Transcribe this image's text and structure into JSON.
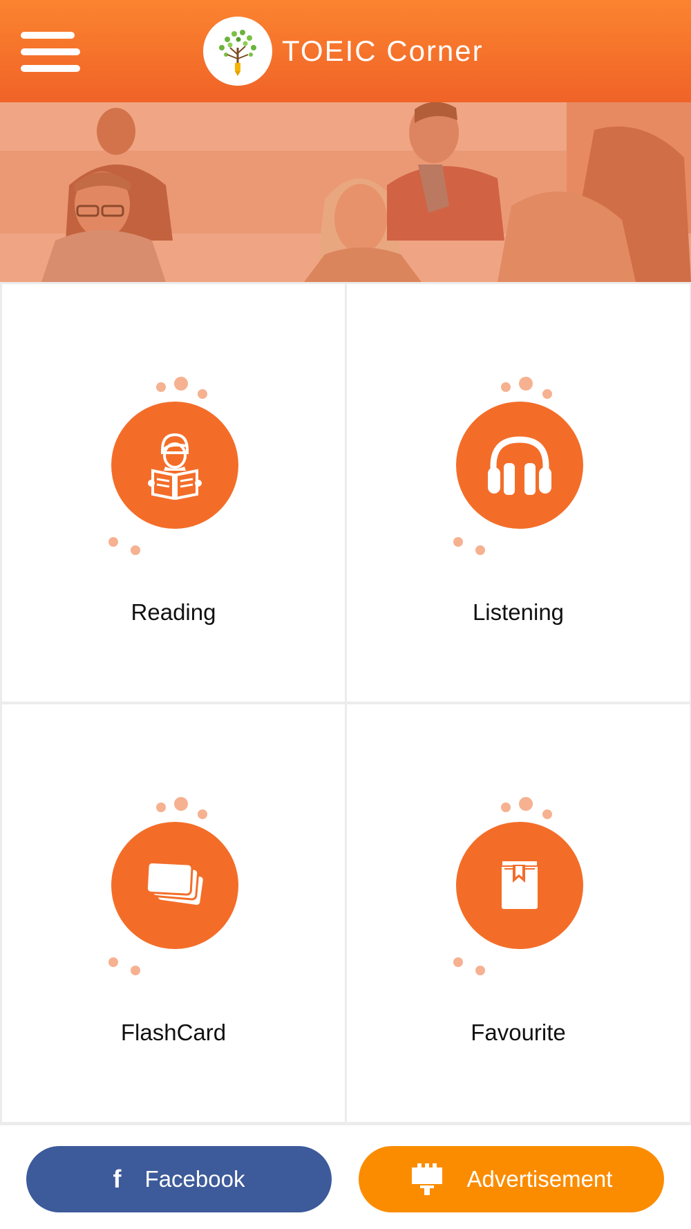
{
  "header": {
    "title": "TOEIC Corner",
    "menu_icon": "hamburger-menu-icon",
    "logo_icon": "tree-pencil-logo"
  },
  "banner": {
    "description_icon": "students-photo-banner",
    "overlay_color": "#f07a45"
  },
  "tiles": [
    {
      "label": "Reading",
      "icon": "reading-student-icon"
    },
    {
      "label": "Listening",
      "icon": "headphones-icon"
    },
    {
      "label": "FlashCard",
      "icon": "flashcards-icon"
    },
    {
      "label": "Favourite",
      "icon": "bookmark-book-icon"
    }
  ],
  "footer": {
    "facebook_label": "Facebook",
    "facebook_icon": "facebook-icon",
    "advertisement_label": "Advertisement",
    "advertisement_icon": "billboard-icon"
  },
  "colors": {
    "accent": "#f36d29",
    "header_top": "#fb8430",
    "header_bottom": "#f06327",
    "facebook": "#3d5a9a",
    "advertisement": "#fb8c00",
    "dots": "#f6b190"
  }
}
